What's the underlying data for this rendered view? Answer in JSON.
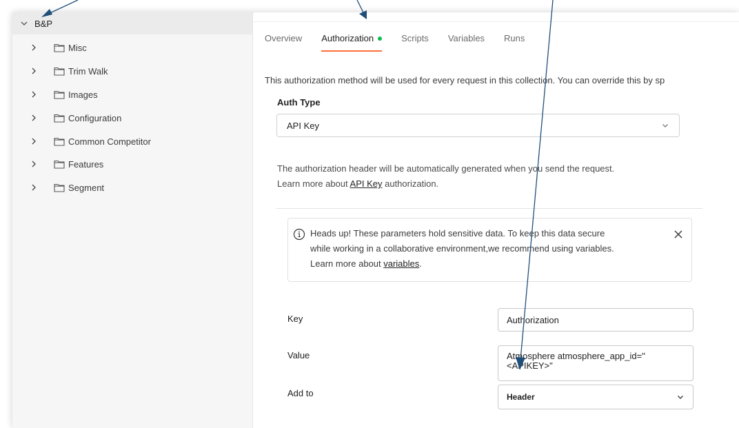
{
  "sidebar": {
    "collection": "B&P",
    "folders": [
      {
        "label": "Misc"
      },
      {
        "label": "Trim Walk"
      },
      {
        "label": "Images"
      },
      {
        "label": "Configuration"
      },
      {
        "label": "Common Competitor"
      },
      {
        "label": "Features"
      },
      {
        "label": "Segment"
      }
    ]
  },
  "tabs": [
    {
      "label": "Overview"
    },
    {
      "label": "Authorization"
    },
    {
      "label": "Scripts"
    },
    {
      "label": "Variables"
    },
    {
      "label": "Runs"
    }
  ],
  "auth": {
    "description": "This authorization method will be used for every request in this collection. You can override this by sp",
    "type_label": "Auth Type",
    "type_value": "API Key",
    "info_line1": "The authorization header will be automatically generated when you send the request.",
    "info_prefix": "Learn more about ",
    "info_link": "API Key",
    "info_suffix": " authorization."
  },
  "callout": {
    "line1": "Heads up! These parameters hold sensitive data. To keep this data secure",
    "line2": "while working in a collaborative environment,we recommend using variables.",
    "line3_prefix": "Learn more about ",
    "line3_link": "variables",
    "line3_suffix": "."
  },
  "fields": {
    "key_label": "Key",
    "key_value": "Authorization",
    "value_label": "Value",
    "value_line1": "Atmosphere atmosphere_app_id=\"",
    "value_line2": "<APIKEY>\"",
    "addto_label": "Add to",
    "addto_value": "Header"
  },
  "colors": {
    "accent": "#ff6c37",
    "status_dot": "#0cbb52",
    "arrow": "#1f4e79"
  }
}
